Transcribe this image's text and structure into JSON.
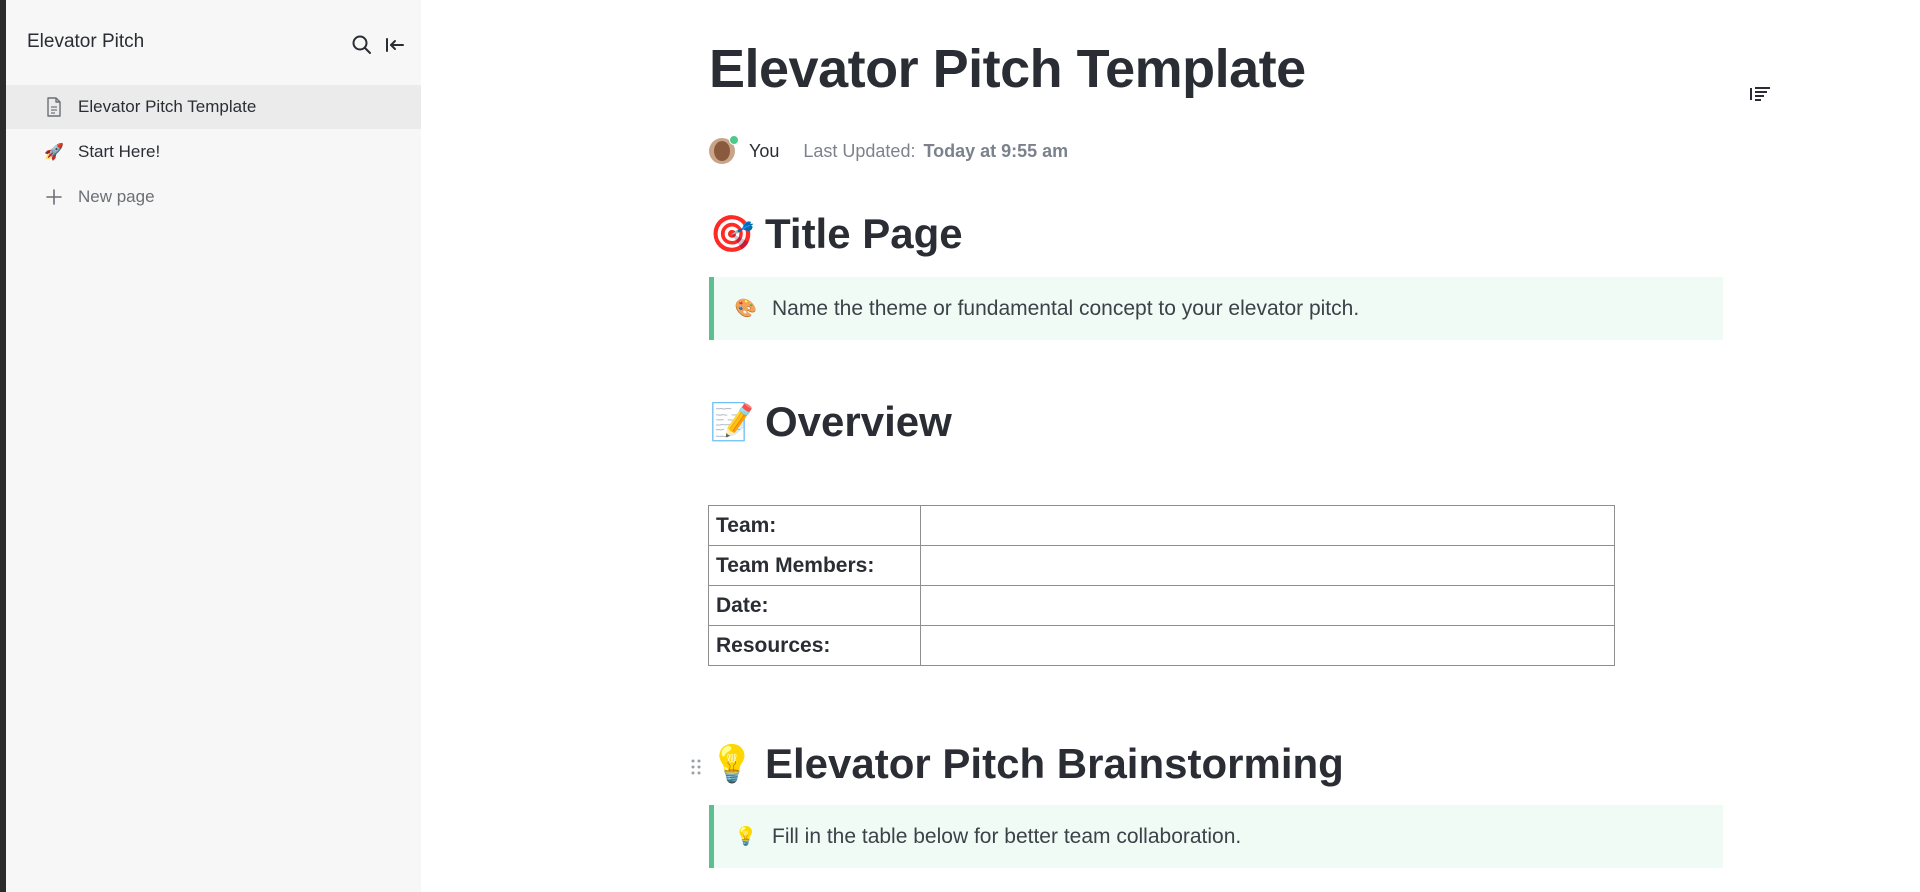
{
  "sidebar": {
    "title": "Elevator Pitch",
    "search_icon": "search-icon",
    "collapse_icon": "collapse-sidebar-icon",
    "items": [
      {
        "label": "Elevator Pitch Template",
        "icon": "document-icon",
        "active": true
      },
      {
        "label": "Start Here!",
        "icon": "rocket-icon",
        "emoji": "🚀",
        "active": false
      },
      {
        "label": "New page",
        "icon": "plus-icon",
        "active": false
      }
    ]
  },
  "doc": {
    "title": "Elevator Pitch Template",
    "author": "You",
    "last_updated_label": "Last Updated:",
    "last_updated_value": "Today at 9:55 am",
    "toc_icon": "table-of-contents-icon"
  },
  "sections": {
    "title_page": {
      "emoji": "🎯",
      "heading": "Title Page",
      "callout_emoji": "🎨",
      "callout_text": "Name the theme or fundamental concept to your elevator pitch."
    },
    "overview": {
      "emoji": "📝",
      "heading": "Overview",
      "rows": [
        {
          "label": "Team:",
          "value": ""
        },
        {
          "label": "Team Members:",
          "value": ""
        },
        {
          "label": "Date:",
          "value": ""
        },
        {
          "label": "Resources:",
          "value": ""
        }
      ]
    },
    "brainstorming": {
      "emoji": "💡",
      "heading": "Elevator Pitch Brainstorming",
      "callout_emoji": "💡",
      "callout_text": "Fill in the table below for better team collaboration."
    }
  },
  "colors": {
    "callout_bg": "#effbf4",
    "callout_border": "#5cbf8f",
    "sidebar_bg": "#f7f7f7",
    "active_item_bg": "#ebebeb",
    "online_dot": "#4ec98a"
  }
}
